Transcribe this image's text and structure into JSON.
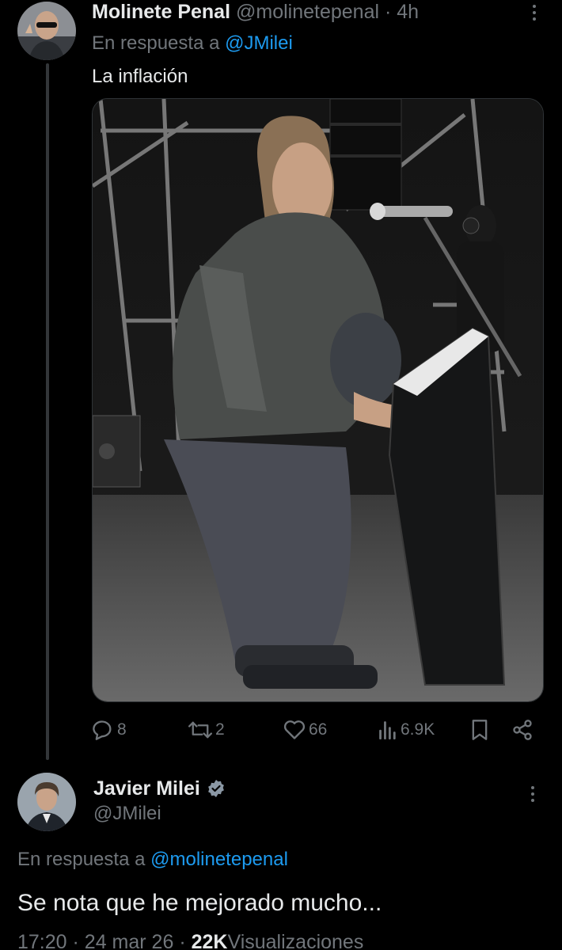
{
  "tweet1": {
    "author_name": "Molinete Penal",
    "author_handle": "@molinetepenal",
    "separator": "·",
    "time": "4h",
    "reply_prefix": "En respuesta a",
    "reply_handle": "@JMilei",
    "text": "La inflación",
    "replies": "8",
    "retweets": "2",
    "likes": "66",
    "views": "6.9K"
  },
  "tweet2": {
    "author_name": "Javier Milei",
    "author_handle": "@JMilei",
    "verified": true,
    "reply_prefix": "En respuesta a",
    "reply_handle": "@molinetepenal",
    "text": "Se nota que he mejorado mucho...",
    "time": "17:20",
    "date": "24 mar 26",
    "views_count": "22K",
    "views_label": "Visualizaciones",
    "meta_separator": "·"
  },
  "colors": {
    "background": "#000000",
    "text": "#e7e9ea",
    "muted": "#71767b",
    "link": "#1d9bf0",
    "verified": "#1d9bf0"
  },
  "icons": {
    "reply": "reply-bubble-icon",
    "retweet": "retweet-icon",
    "like": "heart-icon",
    "views": "bar-chart-icon",
    "bookmark": "bookmark-icon",
    "share": "share-icon",
    "more": "more-vertical-icon",
    "verified": "verified-badge-icon"
  }
}
